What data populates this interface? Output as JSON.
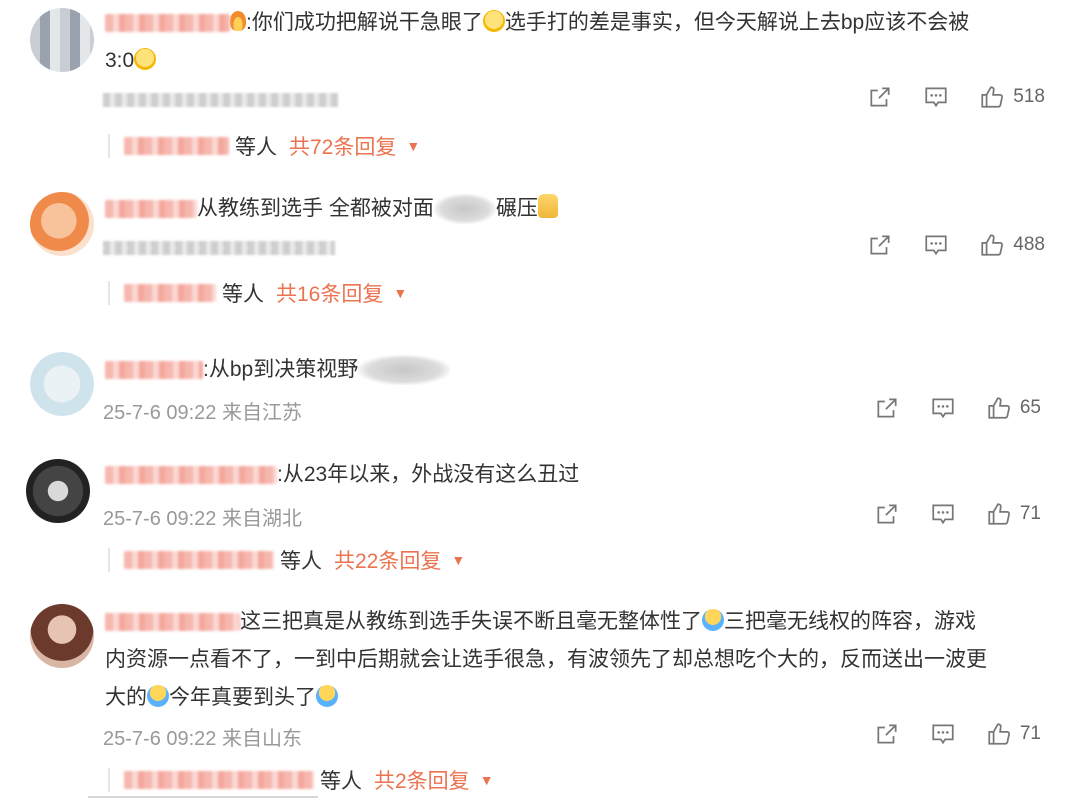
{
  "comments": [
    {
      "text_1": ":你们成功把解说干急眼了",
      "text_2": "选手打的差是事实，但今天解说上去bp应该不会被",
      "text_3": "3:0",
      "likes": "518",
      "replies_suffix": "等人",
      "replies_link": "共72条回复"
    },
    {
      "text_1": "从教练到选手 全都被对面",
      "text_2": "碾压",
      "likes": "488",
      "replies_suffix": "等人",
      "replies_link": "共16条回复"
    },
    {
      "text_1": ":从bp到决策视野",
      "meta": "25-7-6 09:22 来自江苏",
      "likes": "65"
    },
    {
      "text_1": ":从23年以来，外战没有这么丑过",
      "meta": "25-7-6 09:22 来自湖北",
      "likes": "71",
      "replies_suffix": "等人",
      "replies_link": "共22条回复"
    },
    {
      "text_1": "这三把真是从教练到选手失误不断且毫无整体性了",
      "text_2": "三把毫无线权的阵容，游戏",
      "text_3": "内资源一点看不了，一到中后期就会让选手很急，有波领先了却总想吃个大的，反而送出一波更",
      "text_4": "大的",
      "text_5": "今年真要到头了",
      "meta": "25-7-6 09:22 来自山东",
      "likes": "71",
      "replies_suffix": "等人",
      "replies_link": "共2条回复"
    }
  ],
  "icons": {
    "share": "share-icon",
    "comment": "comment-icon",
    "like": "thumbs-up-icon",
    "caret": "caret-down-icon"
  },
  "colors": {
    "accent": "#eb7350",
    "meta": "#999999",
    "text": "#333333"
  }
}
